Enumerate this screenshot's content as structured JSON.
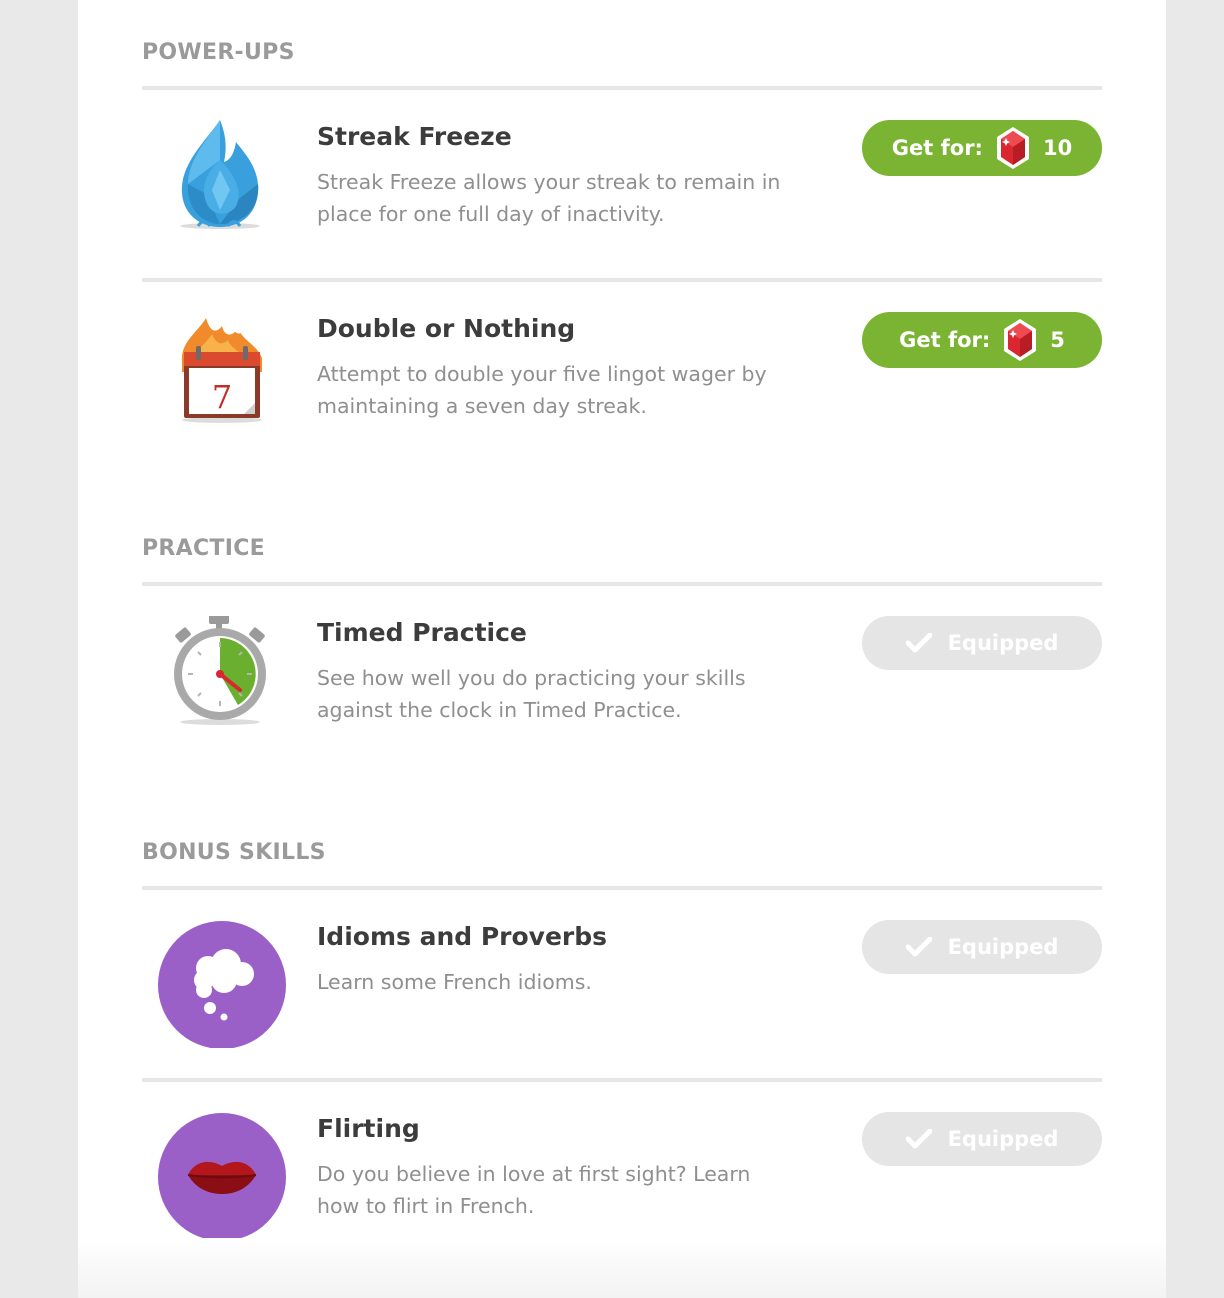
{
  "sections": [
    {
      "title": "POWER-UPS",
      "items": [
        {
          "title": "Streak Freeze",
          "description": "Streak Freeze allows your streak to remain in place for one full day of inactivity.",
          "icon": "ice-flame-icon",
          "button": {
            "state": "buy",
            "label": "Get for:",
            "price": "10",
            "price_icon": "lingot-gem-icon"
          }
        },
        {
          "title": "Double or Nothing",
          "description": "Attempt to double your five lingot wager by maintaining a seven day streak.",
          "icon": "burning-calendar-icon",
          "calendar_day": "7",
          "button": {
            "state": "buy",
            "label": "Get for:",
            "price": "5",
            "price_icon": "lingot-gem-icon"
          }
        }
      ]
    },
    {
      "title": "PRACTICE",
      "items": [
        {
          "title": "Timed Practice",
          "description": "See how well you do practicing your skills against the clock in Timed Practice.",
          "icon": "stopwatch-icon",
          "button": {
            "state": "equipped",
            "label": "Equipped",
            "icon": "checkmark-icon"
          }
        }
      ]
    },
    {
      "title": "BONUS SKILLS",
      "items": [
        {
          "title": "Idioms and Proverbs",
          "description": "Learn some French idioms.",
          "icon": "thought-bubble-icon",
          "button": {
            "state": "equipped",
            "label": "Equipped",
            "icon": "checkmark-icon"
          }
        },
        {
          "title": "Flirting",
          "description": "Do you believe in love at first sight? Learn how to flirt in French.",
          "icon": "lips-icon",
          "button": {
            "state": "equipped",
            "label": "Equipped",
            "icon": "checkmark-icon"
          }
        }
      ]
    }
  ],
  "colors": {
    "buy_button": "#7ab432",
    "equipped_button": "#e5e5e5",
    "skill_circle": "#9b5fc8",
    "gem": "#d9262f",
    "section_title": "#9a9a9a",
    "item_title": "#3c3c3c",
    "item_description": "#8f8f8f"
  }
}
